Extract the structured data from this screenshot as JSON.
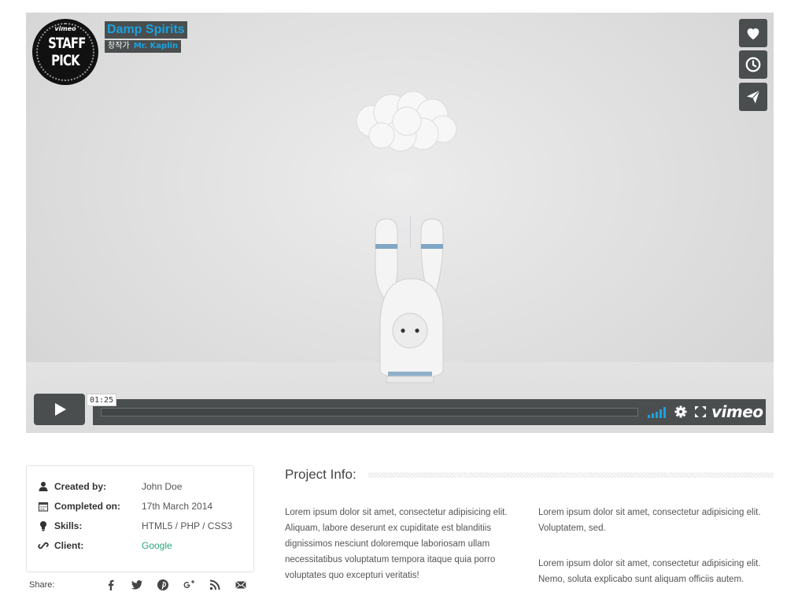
{
  "video": {
    "badge_top": "vimeo",
    "badge_main": "STAFF PICK",
    "title": "Damp Spirits",
    "byline_prefix": "창작가",
    "author": "Mr. Kaplin",
    "current_time": "01:25",
    "brand": "vimeo",
    "side_buttons": [
      "heart-icon",
      "clock-icon",
      "paper-plane-icon"
    ],
    "accent_color": "#1aa3e0"
  },
  "details": {
    "rows": [
      {
        "icon": "user-icon",
        "label": "Created by:",
        "value": "John Doe"
      },
      {
        "icon": "calendar-icon",
        "label": "Completed on:",
        "value": "17th March 2014"
      },
      {
        "icon": "lightbulb-icon",
        "label": "Skills:",
        "value": "HTML5 / PHP / CSS3"
      },
      {
        "icon": "link-icon",
        "label": "Client:",
        "value": "Google"
      }
    ],
    "link_color": "#2ca67d"
  },
  "share": {
    "label": "Share:",
    "networks": [
      "facebook-icon",
      "twitter-icon",
      "pinterest-icon",
      "google-plus-icon",
      "rss-icon",
      "email-icon"
    ]
  },
  "project": {
    "title": "Project Info:",
    "col1": "Lorem ipsum dolor sit amet, consectetur adipisicing elit. Aliquam, labore deserunt ex cupiditate est blanditiis dignissimos nesciunt doloremque laboriosam ullam necessitatibus voluptatum tempora itaque quia porro voluptates quo excepturi veritatis!",
    "col2a": "Lorem ipsum dolor sit amet, consectetur adipisicing elit. Voluptatem, sed.",
    "col2b": "Lorem ipsum dolor sit amet, consectetur adipisicing elit. Nemo, soluta explicabo sunt aliquam officiis autem."
  }
}
